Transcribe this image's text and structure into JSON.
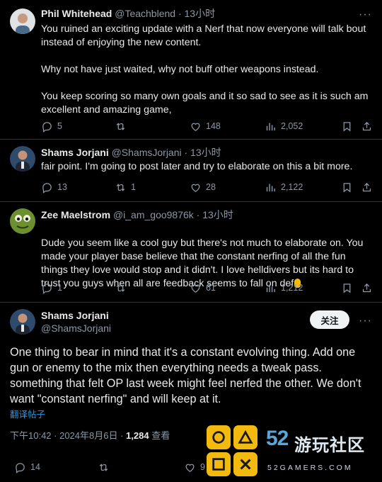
{
  "replies": [
    {
      "name": "Phil Whitehead",
      "meta": "@Teachblend · 13小时",
      "text": "You ruined an exciting update with a Nerf that now everyone will talk bout instead of enjoying the new content.\n\nWhy not have just waited, why not buff other weapons instead.\n\nYou keep scoring so many own goals and it so sad to see as it is such am excellent and amazing game,",
      "replies": "5",
      "reposts": "",
      "likes": "148",
      "views": "2,052"
    },
    {
      "name": "Shams Jorjani",
      "meta": "@ShamsJorjani · 13小时",
      "text": "fair point. I'm going to post later and try to elaborate on this a bit more.",
      "replies": "13",
      "reposts": "1",
      "likes": "28",
      "views": "2,122"
    },
    {
      "name": "Zee Maelstrom",
      "meta": "@i_am_goo9876k · 13小时",
      "text": "Dude you seem like a cool guy but there's not much to elaborate on. You made your player base believe that the constant nerfing of all the fun things they love would stop and it didn't. I love helldivers  but its hard to trust you guys when all are feedback seems to fall on def",
      "replies": "1",
      "reposts": "",
      "likes": "61",
      "views": "1,212"
    }
  ],
  "main": {
    "name": "Shams Jorjani",
    "handle": "@ShamsJorjani",
    "follow_label": "关注",
    "text": "One thing to bear in mind that it's a constant evolving thing. Add one gun or enemy to the mix then everything needs a tweak pass. something that felt OP last week might feel nerfed the other. We don't want \"constant nerfing\" and will keep at it.",
    "translate_label": "翻译帖子",
    "timestamp": "下午10:42 · 2024年8月6日 · ",
    "views_count": "1,284",
    "views_label": " 查看",
    "replies": "14",
    "likes": "9"
  },
  "watermark": {
    "number": "52",
    "chinese": "游玩社区",
    "url": "52GAMERS.COM"
  },
  "colors": {
    "background": "#000000",
    "text": "#e7e9ea",
    "muted": "#8b98a5",
    "link": "#1d9bf0",
    "separator": "#2f3336",
    "watermark_yellow": "#f2b90f",
    "watermark_blue": "#5aa5d9"
  },
  "icons": [
    "reply-icon",
    "repost-icon",
    "like-icon",
    "views-icon",
    "bookmark-icon",
    "share-icon",
    "more-icon"
  ]
}
